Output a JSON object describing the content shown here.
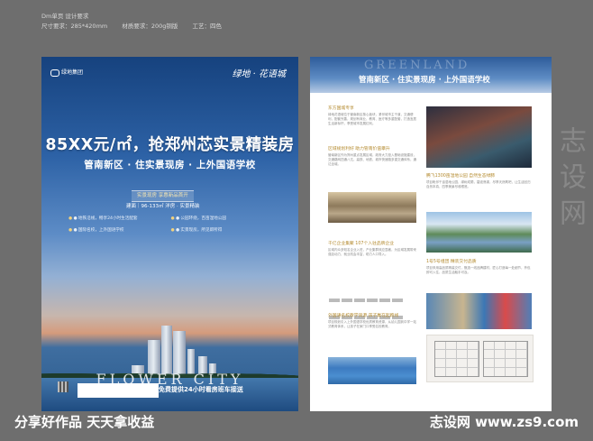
{
  "spec": {
    "line1": "Dm单页 设计要求",
    "size": "尺寸要求：285*420mm",
    "material": "材质要求：200g铜版",
    "craft": "工艺：四色"
  },
  "front": {
    "logo_left": "绿地集团",
    "logo_right": "绿地 · 花语城",
    "headline": "85XX元/㎡，抢郑州芯实景精装房",
    "subhead": "管南新区 · 住实景现房 · 上外国语学校",
    "tag": "实景现房   享惠新品首开",
    "info": "建面｜96-133㎡ 洋房 · 实景精装",
    "points": [
      "● 地铁沿线，畅享24小时生活配套",
      "● 公园环绕，百亩湿地公园",
      "● 国际名校，上外国语学校",
      "● 实景现房，所见即所得"
    ],
    "city_text": "FLOWER CITY",
    "bus_text": "免费提供24小时看房班车接送"
  },
  "back": {
    "ghost_text": "GREENLAND",
    "title": "管南新区 · 住实景现房 · 上外国语学校",
    "sections": [
      {
        "title": "东方国城专享",
        "text": "绿地花语城位于管南新区核心板块，紧邻城市主干道，交通便利，配套完善，规划有商业、教育、医疗等多重配套，打造宜居生活新标杆，享受城市发展红利。"
      },
      {
        "title": "区域规划利好 助力管南价值攀升",
        "text": "管南新区作为郑州重点发展区域，政府大力投入基础设施建设，交通路网四通八达，高铁、地铁、城市快速路多重交通体系，通达全城。"
      },
      {
        "title": "腾飞1300亩湿地公园 自然生态绿肺",
        "text": "项目毗邻千亩湿地公园，绿树成荫，碧波荡漾，尽享天然氧吧，让生活回归自然本真，四季美景尽收眼底。"
      },
      {
        "title": "千亿企业集聚 107个入驻品牌企业",
        "text": "区域内众多知名企业入驻，产业集群效应显著，为区域发展带来强劲动力，就业机会丰富，助力人口导入。"
      },
      {
        "title": "1号5号组团 精装交付品质",
        "text": "项目采用高品质精装交付，甄选一线品牌建材，匠心打造每一处细节，拎包即可入住，品质生活触手可及。"
      },
      {
        "title": "外国语名校教学资源 孩子赢在起跑线",
        "text": "项目规划引入上外国语学校优质教育资源，从幼儿园到中学一站式教育体系，让孩子在家门口享受名校教育。"
      }
    ]
  },
  "footer": {
    "left": "分享好作品 天天拿收益",
    "right": "志设网 www.zs9.com"
  },
  "watermark": "志设网"
}
